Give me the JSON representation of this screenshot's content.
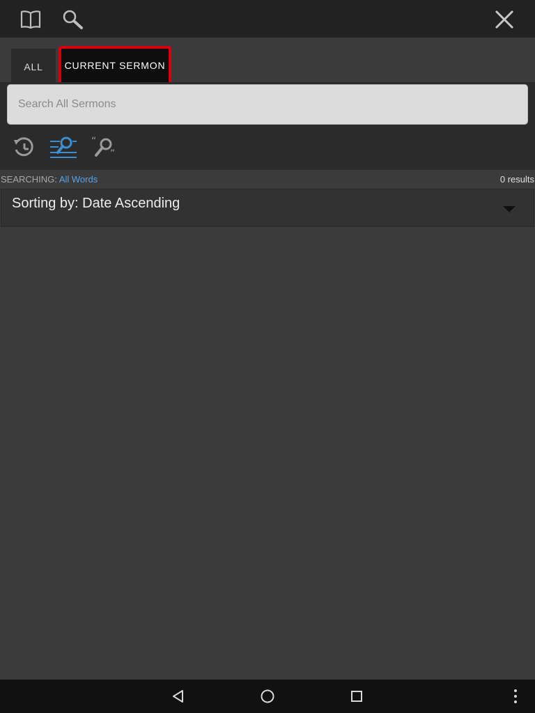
{
  "header": {
    "icons": [
      "book-icon",
      "search-icon",
      "close-icon"
    ]
  },
  "tabs": [
    {
      "label": "ALL",
      "selected": false
    },
    {
      "label": "CURRENT SERMON",
      "selected": true
    }
  ],
  "search": {
    "placeholder": "Search All Sermons",
    "value": ""
  },
  "tools": [
    {
      "icon": "history-icon",
      "active": false
    },
    {
      "icon": "search-filter-icon",
      "active": true
    },
    {
      "icon": "search-quote-icon",
      "active": false
    }
  ],
  "status": {
    "searching_label": "SEARCHING:",
    "searching_mode": "All Words",
    "results": "0 results"
  },
  "sort": {
    "label": "Sorting by: Date Ascending"
  },
  "colors": {
    "accent": "#5aa3e6",
    "highlight": "#d4000c",
    "topbar": "#222222",
    "background": "#3b3b3b"
  },
  "navbar": {
    "icons": [
      "back-icon",
      "home-icon",
      "recents-icon",
      "more-icon"
    ]
  }
}
